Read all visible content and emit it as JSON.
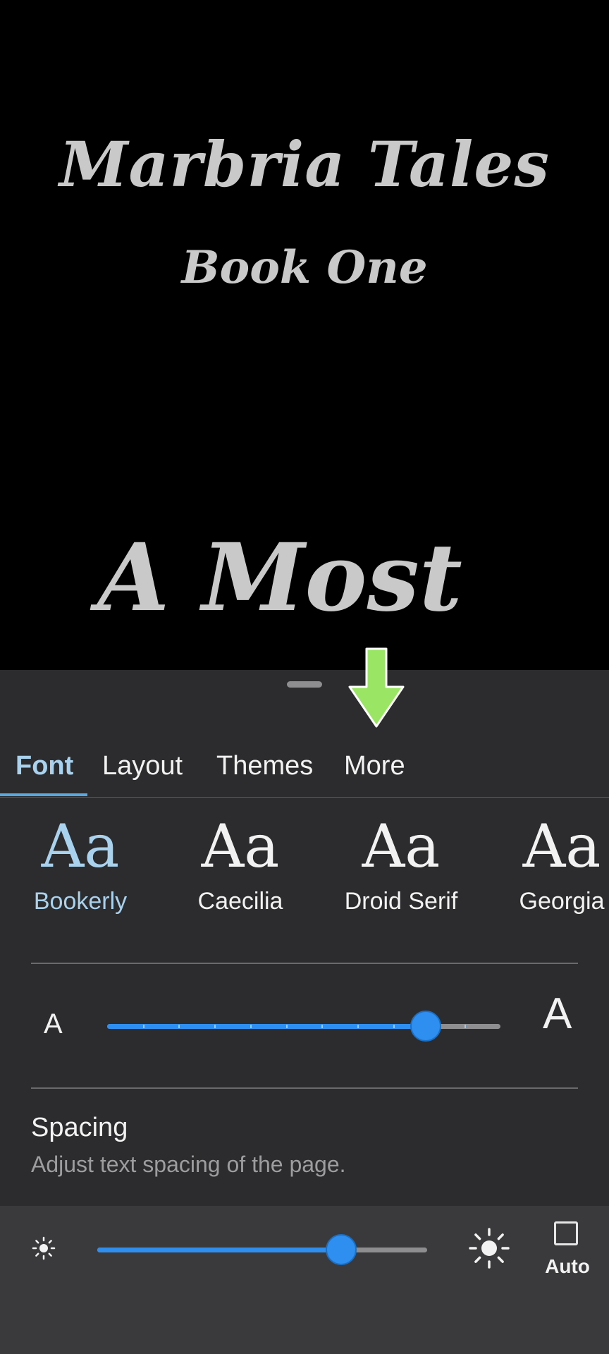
{
  "book": {
    "title": "Marbria Tales",
    "subtitle": "Book One",
    "chapter_heading": "A Most"
  },
  "tabs": [
    {
      "label": "Font",
      "active": true
    },
    {
      "label": "Layout",
      "active": false
    },
    {
      "label": "Themes",
      "active": false
    },
    {
      "label": "More",
      "active": false
    }
  ],
  "fonts": [
    {
      "sample": "Aa",
      "name": "Bookerly",
      "selected": true
    },
    {
      "sample": "Aa",
      "name": "Caecilia",
      "selected": false
    },
    {
      "sample": "Aa",
      "name": "Droid Serif",
      "selected": false
    },
    {
      "sample": "Aa",
      "name": "Georgia",
      "selected": false
    }
  ],
  "font_size": {
    "small_label": "A",
    "large_label": "A",
    "level_fraction": 0.81
  },
  "spacing": {
    "title": "Spacing",
    "description": "Adjust text spacing of the page."
  },
  "brightness": {
    "level_fraction": 0.74,
    "auto_label": "Auto",
    "auto_checked": false
  },
  "colors": {
    "accent": "#2e8ff0",
    "active_tab": "#a9d2ef",
    "sheet_bg": "#2c2c2e",
    "hint_arrow": "#9be564"
  }
}
